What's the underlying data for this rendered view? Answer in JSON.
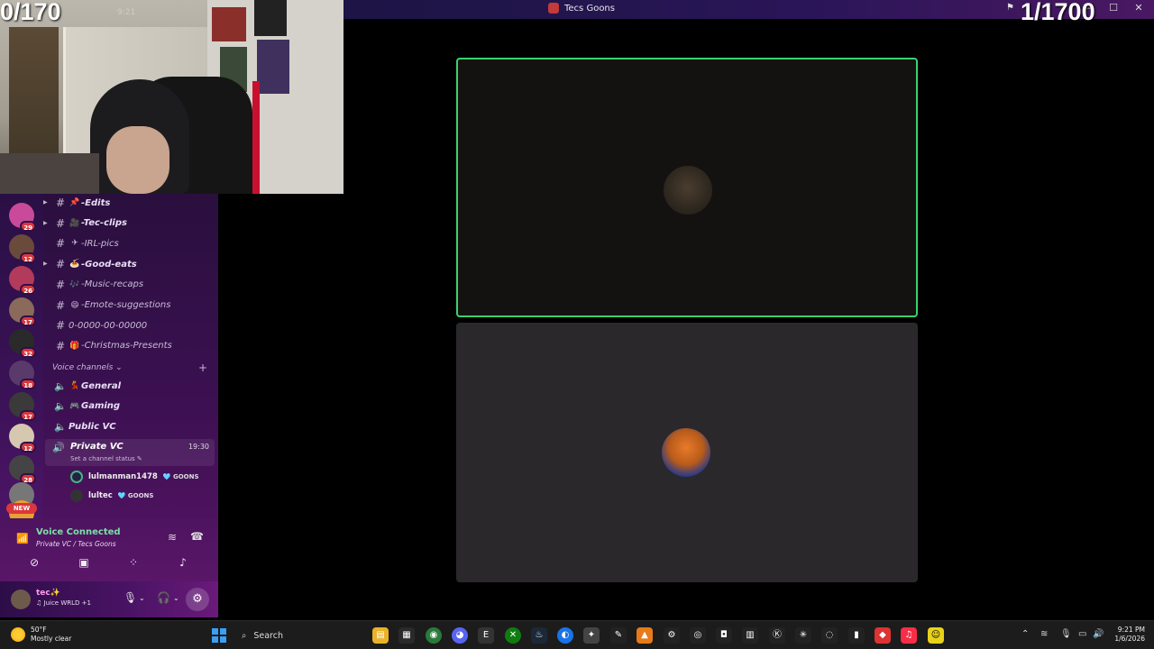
{
  "overlay": {
    "counter_left": "0/170",
    "counter_right": "1/1700",
    "cam_tag": "9:21"
  },
  "window": {
    "title": "Tecs Goons"
  },
  "servers": [
    {
      "badge": "29",
      "color": "#c94a9a"
    },
    {
      "badge": "12",
      "color": "#6a4a3a"
    },
    {
      "badge": "26",
      "color": "#b23a5a"
    },
    {
      "badge": "17",
      "color": "#8a6a5a"
    },
    {
      "badge": "32",
      "color": "#2a2a2a"
    },
    {
      "badge": "18",
      "color": "#5a3a6a"
    },
    {
      "badge": "17",
      "color": "#3a3a3a"
    },
    {
      "badge": "12",
      "color": "#d6c7b0"
    },
    {
      "badge": "28",
      "color": "#444444"
    },
    {
      "badge": "",
      "color": "#777777"
    },
    {
      "badge": "",
      "color": "#e8a030"
    }
  ],
  "new_badge": "NEW",
  "channels": [
    {
      "icon": "pin-icon",
      "emoji": "📌",
      "label": "-Edits",
      "arrow": true
    },
    {
      "icon": "clip-icon",
      "emoji": "🎥",
      "label": "-Tec-clips",
      "arrow": true
    },
    {
      "icon": "camera-icon",
      "emoji": "✈",
      "label": "-IRL-pics",
      "arrow": false,
      "dim": true
    },
    {
      "icon": "food-icon",
      "emoji": "🍝",
      "label": "-Good-eats",
      "arrow": true
    },
    {
      "icon": "music-icon",
      "emoji": "🎶",
      "label": "-Music-recaps",
      "arrow": false,
      "dim": true
    },
    {
      "icon": "emote-icon",
      "emoji": "😄",
      "label": "-Emote-suggestions",
      "arrow": false,
      "dim": true
    },
    {
      "icon": "",
      "emoji": "",
      "label": "0-0000-00-00000",
      "arrow": false,
      "dim": true,
      "plain": true
    },
    {
      "icon": "gift-icon",
      "emoji": "🎁",
      "label": "-Christmas-Presents",
      "arrow": false,
      "dim": true
    }
  ],
  "voice_section": {
    "label": "Voice channels",
    "add": "+"
  },
  "voice_channels": [
    {
      "emoji": "💃",
      "label": "General"
    },
    {
      "emoji": "🎮",
      "label": "Gaming"
    },
    {
      "emoji": "",
      "label": "Public VC"
    }
  ],
  "private_vc": {
    "label": "Private VC",
    "time": "19:30",
    "status": "Set a channel status ✎"
  },
  "members": [
    {
      "name": "lulmanman1478",
      "tag": "🩵 GOONS",
      "speaking": true
    },
    {
      "name": "lultec",
      "tag": "🩵 GOONS",
      "speaking": false
    }
  ],
  "voice_panel": {
    "title": "Voice Connected",
    "subtitle": "Private VC / Tecs Goons"
  },
  "user_panel": {
    "username": "tec✨",
    "status": "♫ Juice WRLD +1"
  },
  "taskbar": {
    "weather_temp": "50°F",
    "weather_desc": "Mostly clear",
    "search_label": "Search",
    "time": "9:21 PM",
    "date": "1/6/2026"
  },
  "colors": {
    "speaking_border": "#3bd16f",
    "accent_green": "#43b581",
    "badge_red": "#da373c"
  }
}
